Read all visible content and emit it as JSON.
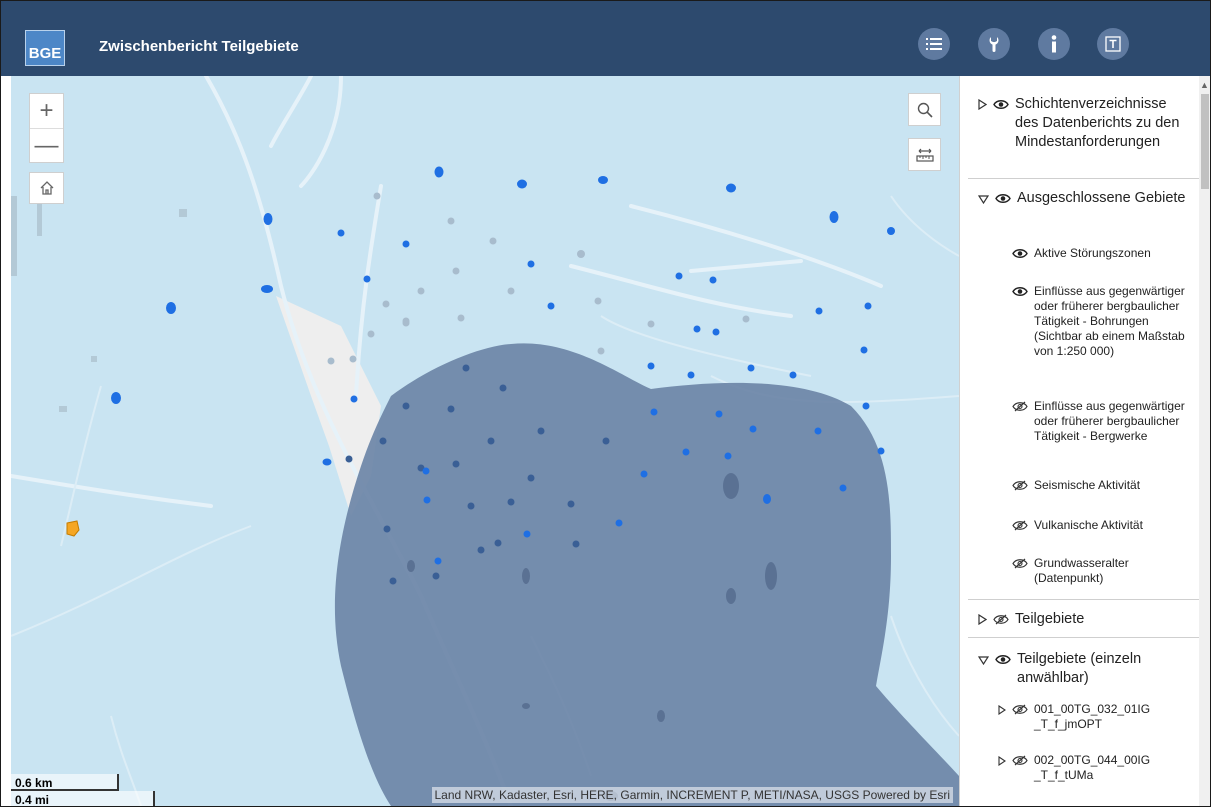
{
  "header": {
    "logo_text": "BGE",
    "title": "Zwischenbericht Teilgebiete",
    "buttons": [
      {
        "icon": "list-icon"
      },
      {
        "icon": "wrench-icon"
      },
      {
        "icon": "info-icon"
      },
      {
        "icon": "text-tool-icon"
      }
    ]
  },
  "map": {
    "zoom_in": "+",
    "zoom_out": "—",
    "attribution": "Land NRW, Kadaster, Esri, HERE, Garmin, INCREMENT P, METI/NASA, USGS    Powered by Esri",
    "scale_km": "0.6 km",
    "scale_mi": "0.4 mi",
    "colors": {
      "background": "#c9e4f2",
      "area_fill": "#6d86a7",
      "point": "#1f6fe3",
      "point_faint": "#a8bccd",
      "highlight_point": "#f5a623"
    }
  },
  "layers": [
    {
      "type": "group",
      "expanded": false,
      "visible": true,
      "label": "Schichtenverzeichnisse des Datenberichts zu den Mindestanforderungen"
    },
    {
      "type": "group",
      "expanded": true,
      "visible": true,
      "label": "Ausgeschlossene Gebiete",
      "children": [
        {
          "visible": true,
          "label": "Aktive Störungszonen"
        },
        {
          "visible": true,
          "label": "Einflüsse aus gegenwärtiger oder früherer bergbaulicher Tätigkeit - Bohrungen (Sichtbar ab einem Maßstab von 1:250 000)"
        },
        {
          "visible": false,
          "label": "Einflüsse aus gegenwärtiger oder früherer bergbaulicher Tätigkeit - Bergwerke"
        },
        {
          "visible": false,
          "label": "Seismische Aktivität"
        },
        {
          "visible": false,
          "label": "Vulkanische Aktivität"
        },
        {
          "visible": false,
          "label": "Grundwasseralter (Datenpunkt)"
        }
      ]
    },
    {
      "type": "group",
      "expanded": false,
      "visible": false,
      "label": "Teilgebiete"
    },
    {
      "type": "group",
      "expanded": true,
      "visible": true,
      "label": "Teilgebiete (einzeln anwählbar)",
      "children": [
        {
          "visible": false,
          "expandable": true,
          "label": "001_00TG_032_01IG_T_f_jmOPT"
        },
        {
          "visible": false,
          "expandable": true,
          "label": "002_00TG_044_00IG_T_f_tUMa"
        }
      ]
    }
  ]
}
